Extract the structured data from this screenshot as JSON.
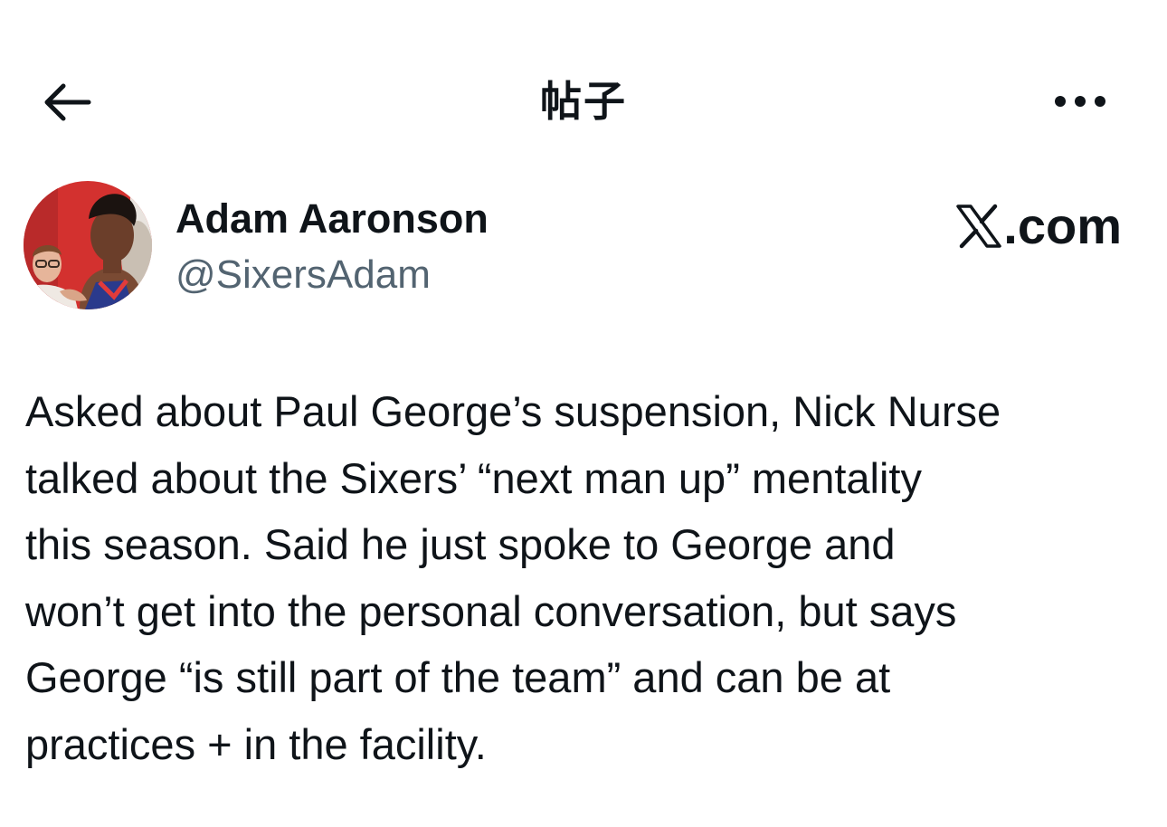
{
  "header": {
    "back_icon": "arrow-left-icon",
    "title": "帖子",
    "more_icon": "more-horizontal-icon"
  },
  "post": {
    "author": {
      "display_name": "Adam Aaronson",
      "handle": "@SixersAdam",
      "avatar_icon": "profile-photo"
    },
    "brand": {
      "logo_icon": "x-logo-icon",
      "suffix": ".com"
    },
    "text": "Asked about Paul George’s suspension, Nick Nurse\ntalked about the Sixers’ “next man up” mentality\nthis season. Said he just spoke to George and\nwon’t get into the personal conversation, but says\nGeorge “is still part of the team” and can be at\npractices + in the facility."
  },
  "colors": {
    "text_primary": "#0f1419",
    "text_secondary": "#536471",
    "background": "#ffffff"
  }
}
